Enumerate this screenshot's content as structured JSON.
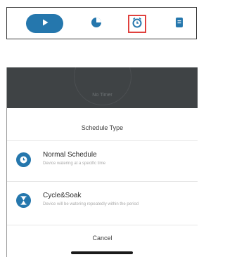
{
  "tabbar": {
    "items": [
      {
        "name": "play",
        "icon": "play-icon",
        "active": true
      },
      {
        "name": "stats",
        "icon": "pie-chart-icon"
      },
      {
        "name": "timer",
        "icon": "alarm-clock-icon",
        "highlighted": true
      },
      {
        "name": "device",
        "icon": "device-icon"
      }
    ]
  },
  "background": {
    "label": "No Timer"
  },
  "sheet": {
    "title": "Schedule Type",
    "options": [
      {
        "title": "Normal Schedule",
        "description": "Device watering at a specific time",
        "icon": "clock-icon"
      },
      {
        "title": "Cycle&Soak",
        "description": "Device will be watering repeatedly within the period",
        "icon": "hourglass-icon"
      }
    ],
    "cancel_label": "Cancel"
  },
  "colors": {
    "accent": "#2577ad",
    "highlight_border": "#e0413e",
    "overlay": "#3f4345"
  }
}
